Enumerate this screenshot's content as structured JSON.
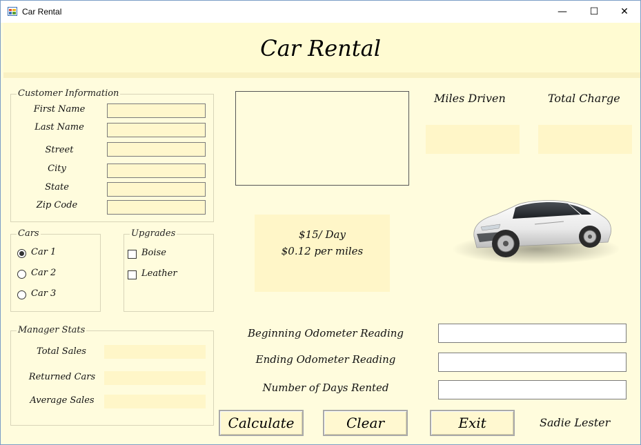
{
  "window": {
    "title": "Car Rental",
    "minimize_glyph": "—",
    "maximize_glyph": "☐",
    "close_glyph": "✕"
  },
  "header": {
    "title": "Car Rental"
  },
  "customer": {
    "group_label": "Customer Information",
    "fields": [
      {
        "label": "First Name",
        "value": ""
      },
      {
        "label": "Last Name",
        "value": ""
      },
      {
        "label": "Street",
        "value": ""
      },
      {
        "label": "City",
        "value": ""
      },
      {
        "label": "State",
        "value": ""
      },
      {
        "label": "Zip Code",
        "value": ""
      }
    ]
  },
  "cars": {
    "group_label": "Cars",
    "options": [
      {
        "label": "Car 1",
        "checked": true
      },
      {
        "label": "Car 2",
        "checked": false
      },
      {
        "label": "Car 3",
        "checked": false
      }
    ]
  },
  "upgrades": {
    "group_label": "Upgrades",
    "options": [
      {
        "label": "Boise",
        "checked": false
      },
      {
        "label": "Leather",
        "checked": false
      }
    ]
  },
  "manager": {
    "group_label": "Manager Stats",
    "stats": [
      {
        "label": "Total Sales",
        "value": ""
      },
      {
        "label": "Returned Cars",
        "value": ""
      },
      {
        "label": "Average Sales",
        "value": ""
      }
    ]
  },
  "rates": {
    "line1": "$15/ Day",
    "line2": "$0.12 per miles"
  },
  "outputs": {
    "miles_label": "Miles Driven",
    "miles_value": "",
    "charge_label": "Total Charge",
    "charge_value": ""
  },
  "odometer": {
    "begin_label": "Beginning Odometer Reading",
    "begin_value": "",
    "end_label": "Ending Odometer Reading",
    "end_value": "",
    "days_label": "Number of Days Rented",
    "days_value": ""
  },
  "buttons": {
    "calculate": "Calculate",
    "clear": "Clear",
    "exit": "Exit"
  },
  "author": "Sadie Lester",
  "car_image": {
    "icon": "car-image",
    "color": "#f2f2f2"
  }
}
